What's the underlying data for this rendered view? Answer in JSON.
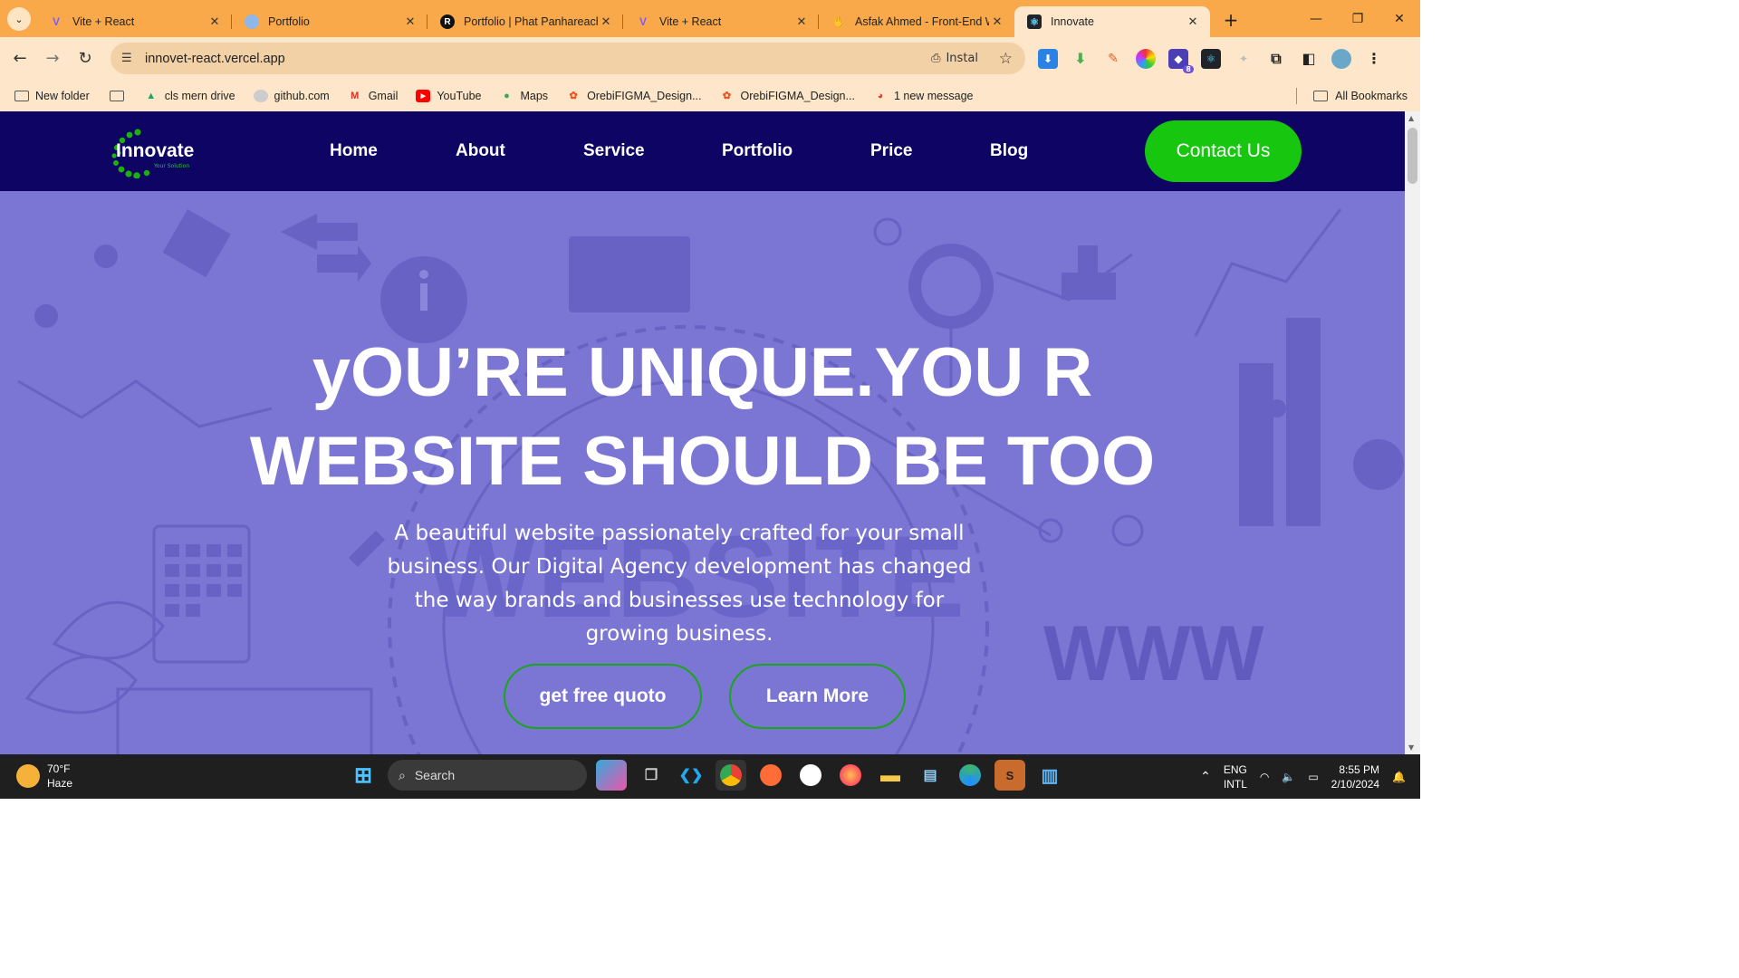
{
  "browser": {
    "tabs": [
      {
        "title": "Vite + React",
        "favicon": "vite-icon",
        "active": false
      },
      {
        "title": "Portfolio",
        "favicon": "globe-icon",
        "active": false
      },
      {
        "title": "Portfolio | Phat Panhareach",
        "favicon": "r-logo-icon",
        "active": false
      },
      {
        "title": "Vite + React",
        "favicon": "vite-icon",
        "active": false
      },
      {
        "title": "Asfak Ahmed - Front-End W",
        "favicon": "hand-icon",
        "active": false
      },
      {
        "title": "Innovate",
        "favicon": "react-icon",
        "active": true
      }
    ],
    "url": "innovet-react.vercel.app",
    "install_label": "Instal",
    "bookmarks": [
      {
        "label": "New folder",
        "icon": "folder-icon"
      },
      {
        "label": "",
        "icon": "folder-icon"
      },
      {
        "label": "cls mern drive",
        "icon": "google-drive-icon"
      },
      {
        "label": "github.com",
        "icon": "github-icon"
      },
      {
        "label": "Gmail",
        "icon": "gmail-icon"
      },
      {
        "label": "YouTube",
        "icon": "youtube-icon"
      },
      {
        "label": "Maps",
        "icon": "maps-icon"
      },
      {
        "label": "OrebiFIGMA_Design...",
        "icon": "figma-icon"
      },
      {
        "label": "OrebiFIGMA_Design...",
        "icon": "figma-icon"
      },
      {
        "label": "1 new message",
        "icon": "message-icon"
      }
    ],
    "all_bookmarks": "All Bookmarks",
    "extension_badge": "8",
    "colors": {
      "tabstrip": "#f9a94a",
      "toolbar": "#fde6c9"
    }
  },
  "site": {
    "logo_word": "Innovate",
    "logo_tagline": "Your Solution",
    "nav": [
      "Home",
      "About",
      "Service",
      "Portfolio",
      "Price",
      "Blog"
    ],
    "contact_label": "Contact Us",
    "hero": {
      "title_line1": "yOU’RE UNIQUE.YOU R",
      "title_line2": "WEBSITE SHOULD BE TOO",
      "subtitle": "A beautiful website passionately crafted for your small business. Our Digital Agency development has changed the way brands and businesses use technology for growing business.",
      "cta_primary": "get free quoto",
      "cta_secondary": "Learn More",
      "background_word": "WEBSITE",
      "background_www": "WWW"
    },
    "colors": {
      "nav_bg": "#0d0463",
      "hero_bg": "#7b76d4",
      "accent_green": "#17c60e"
    }
  },
  "taskbar": {
    "weather_temp": "70°F",
    "weather_desc": "Haze",
    "search_placeholder": "Search",
    "lang_line1": "ENG",
    "lang_line2": "INTL",
    "time": "8:55 PM",
    "date": "2/10/2024"
  }
}
